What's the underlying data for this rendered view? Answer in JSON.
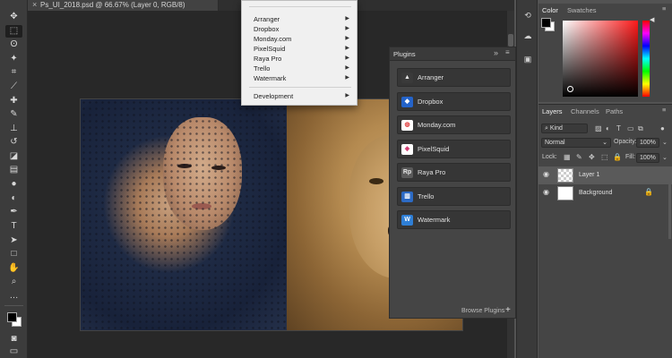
{
  "document": {
    "tab_title": "Ps_UI_2018.psd @ 66.67% (Layer 0, RGB/8)",
    "close_glyph": "×"
  },
  "toolbar": {
    "tools": [
      {
        "name": "move-tool",
        "icon": "move-icon",
        "glyph": "✥"
      },
      {
        "name": "marquee-tool",
        "icon": "rectangular-marquee-icon",
        "glyph": "⬚"
      },
      {
        "name": "lasso-tool",
        "icon": "lasso-icon",
        "glyph": "ʘ"
      },
      {
        "name": "magic-wand-tool",
        "icon": "magic-wand-icon",
        "glyph": "✦"
      },
      {
        "name": "crop-tool",
        "icon": "crop-icon",
        "glyph": "⌗"
      },
      {
        "name": "eyedropper-tool",
        "icon": "eyedropper-icon",
        "glyph": "⟋"
      },
      {
        "name": "healing-tool",
        "icon": "healing-brush-icon",
        "glyph": "✚"
      },
      {
        "name": "brush-tool",
        "icon": "brush-icon",
        "glyph": "✎"
      },
      {
        "name": "clone-stamp-tool",
        "icon": "clone-stamp-icon",
        "glyph": "⊥"
      },
      {
        "name": "history-brush-tool",
        "icon": "history-brush-icon",
        "glyph": "↺"
      },
      {
        "name": "eraser-tool",
        "icon": "eraser-icon",
        "glyph": "◪"
      },
      {
        "name": "gradient-tool",
        "icon": "gradient-icon",
        "glyph": "▤"
      },
      {
        "name": "blur-tool",
        "icon": "blur-icon",
        "glyph": "●"
      },
      {
        "name": "dodge-tool",
        "icon": "dodge-icon",
        "glyph": "◐"
      },
      {
        "name": "pen-tool",
        "icon": "pen-icon",
        "glyph": "✒"
      },
      {
        "name": "type-tool",
        "icon": "type-icon",
        "glyph": "T"
      },
      {
        "name": "path-selection-tool",
        "icon": "path-selection-icon",
        "glyph": "➤"
      },
      {
        "name": "rectangle-tool",
        "icon": "rectangle-icon",
        "glyph": "□"
      },
      {
        "name": "hand-tool",
        "icon": "hand-icon",
        "glyph": "✋"
      },
      {
        "name": "zoom-tool",
        "icon": "zoom-icon",
        "glyph": "⌕"
      },
      {
        "name": "more-tools",
        "icon": "more-icon",
        "glyph": "…"
      }
    ],
    "foreground_color": "#000000",
    "background_color": "#ffffff",
    "quick_mask_glyph": "◙",
    "screen_mode_glyph": "▭"
  },
  "menu": {
    "items": [
      {
        "label": "Arranger",
        "has_submenu": true
      },
      {
        "label": "Dropbox",
        "has_submenu": true
      },
      {
        "label": "Monday.com",
        "has_submenu": true
      },
      {
        "label": "PixelSquid",
        "has_submenu": true
      },
      {
        "label": "Raya Pro",
        "has_submenu": true
      },
      {
        "label": "Trello",
        "has_submenu": true
      },
      {
        "label": "Watermark",
        "has_submenu": true
      }
    ],
    "footer_item": {
      "label": "Development",
      "has_submenu": true
    },
    "submenu_arrow_glyph": "▶"
  },
  "plugins_panel": {
    "title": "Plugins",
    "collapse_glyph": "»",
    "menu_glyph": "≡",
    "plugins": [
      {
        "label": "Arranger",
        "icon": "arranger-icon",
        "glyph": "▲",
        "bg": "#3a3a3a",
        "fg": "#e8e8e8"
      },
      {
        "label": "Dropbox",
        "icon": "dropbox-icon",
        "glyph": "◆",
        "bg": "#2463c9",
        "fg": "#ffffff"
      },
      {
        "label": "Monday.com",
        "icon": "monday-icon",
        "glyph": "◍",
        "bg": "#ffffff",
        "fg": "#e04444"
      },
      {
        "label": "PixelSquid",
        "icon": "pixelsquid-icon",
        "glyph": "◈",
        "bg": "#ffffff",
        "fg": "#d0306a"
      },
      {
        "label": "Raya Pro",
        "icon": "raya-pro-icon",
        "glyph": "Rp",
        "bg": "#5a5a5a",
        "fg": "#e8e8e8"
      },
      {
        "label": "Trello",
        "icon": "trello-icon",
        "glyph": "▥",
        "bg": "#2c6ac4",
        "fg": "#ffffff"
      },
      {
        "label": "Watermark",
        "icon": "watermark-icon",
        "glyph": "W",
        "bg": "#2f7fd6",
        "fg": "#ffffff"
      }
    ],
    "browse_label": "Browse Plugins",
    "browse_plus_glyph": "+"
  },
  "icon_strip": {
    "icons": [
      {
        "name": "history-panel-icon",
        "glyph": "⟲"
      },
      {
        "name": "libraries-panel-icon",
        "glyph": "☁"
      },
      {
        "name": "plugins-panel-icon",
        "glyph": "▣"
      }
    ]
  },
  "color_panel": {
    "tabs": [
      "Color",
      "Swatches"
    ],
    "active_tab": "Color",
    "hue_color": "#ff1a1a",
    "menu_glyph": "≡"
  },
  "layers_panel": {
    "tabs": [
      "Layers",
      "Channels",
      "Paths"
    ],
    "active_tab": "Layers",
    "kind_filter": "Kind",
    "blend_mode": "Normal",
    "opacity_label": "Opacity:",
    "opacity_value": "100%",
    "lock_label": "Lock:",
    "fill_label": "Fill:",
    "fill_value": "100%",
    "layers": [
      {
        "name": "Layer 1",
        "visible": true,
        "selected": true,
        "locked": false,
        "thumbnail": "transparent"
      },
      {
        "name": "Background",
        "visible": true,
        "selected": false,
        "locked": true,
        "thumbnail": "white"
      }
    ],
    "eye_glyph": "◉",
    "lock_glyph": "🔒",
    "menu_glyph": "≡"
  }
}
